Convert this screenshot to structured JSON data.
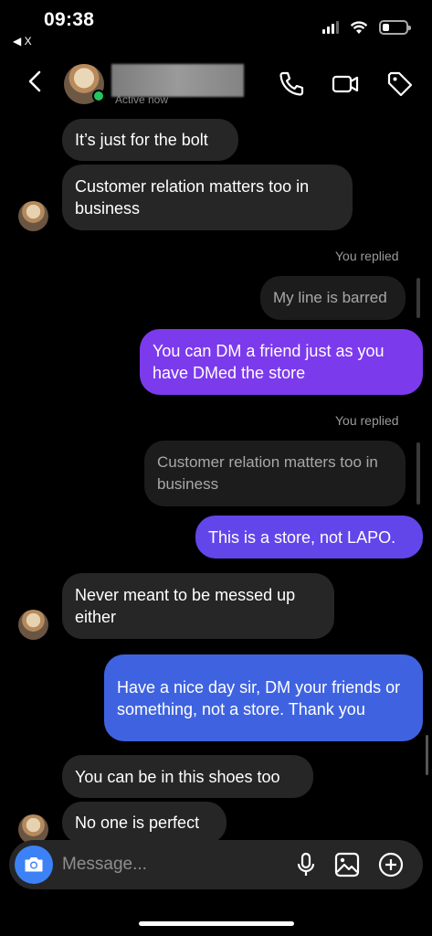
{
  "status_bar": {
    "time": "09:38",
    "back_app": "◀ X",
    "battery_level": 0.3
  },
  "header": {
    "active_status": "Active now"
  },
  "messages": [
    {
      "type": "received",
      "text": "It’s just for the bolt"
    },
    {
      "type": "received",
      "text": "Customer relation matters too in business"
    },
    {
      "type": "replied_label",
      "text": "You replied"
    },
    {
      "type": "reply_quote",
      "text": "My line is barred"
    },
    {
      "type": "sent",
      "text": "You can DM a friend just as you have DMed the store"
    },
    {
      "type": "replied_label",
      "text": "You replied"
    },
    {
      "type": "reply_quote",
      "text": "Customer relation matters too in business"
    },
    {
      "type": "sent",
      "text": "This is a store, not LAPO."
    },
    {
      "type": "received",
      "text": "Never meant to be messed up either"
    },
    {
      "type": "sent",
      "text": "Have a nice day sir, DM your friends or something, not a store. Thank you"
    },
    {
      "type": "received",
      "text": "You can be in this shoes too"
    },
    {
      "type": "received",
      "text": "No one is perfect"
    }
  ],
  "composer": {
    "placeholder": "Message..."
  },
  "colors": {
    "sent_purple": "#7c3aed",
    "sent_violet": "#6246ea",
    "sent_blue": "#3f63e0",
    "received_bg": "#262626",
    "camera_blue": "#3c82f6",
    "online_green": "#22c55e"
  },
  "icons": [
    "chevron-left-icon",
    "phone-icon",
    "video-icon",
    "tag-icon",
    "camera-icon",
    "microphone-icon",
    "photo-icon",
    "plus-circle-icon"
  ]
}
